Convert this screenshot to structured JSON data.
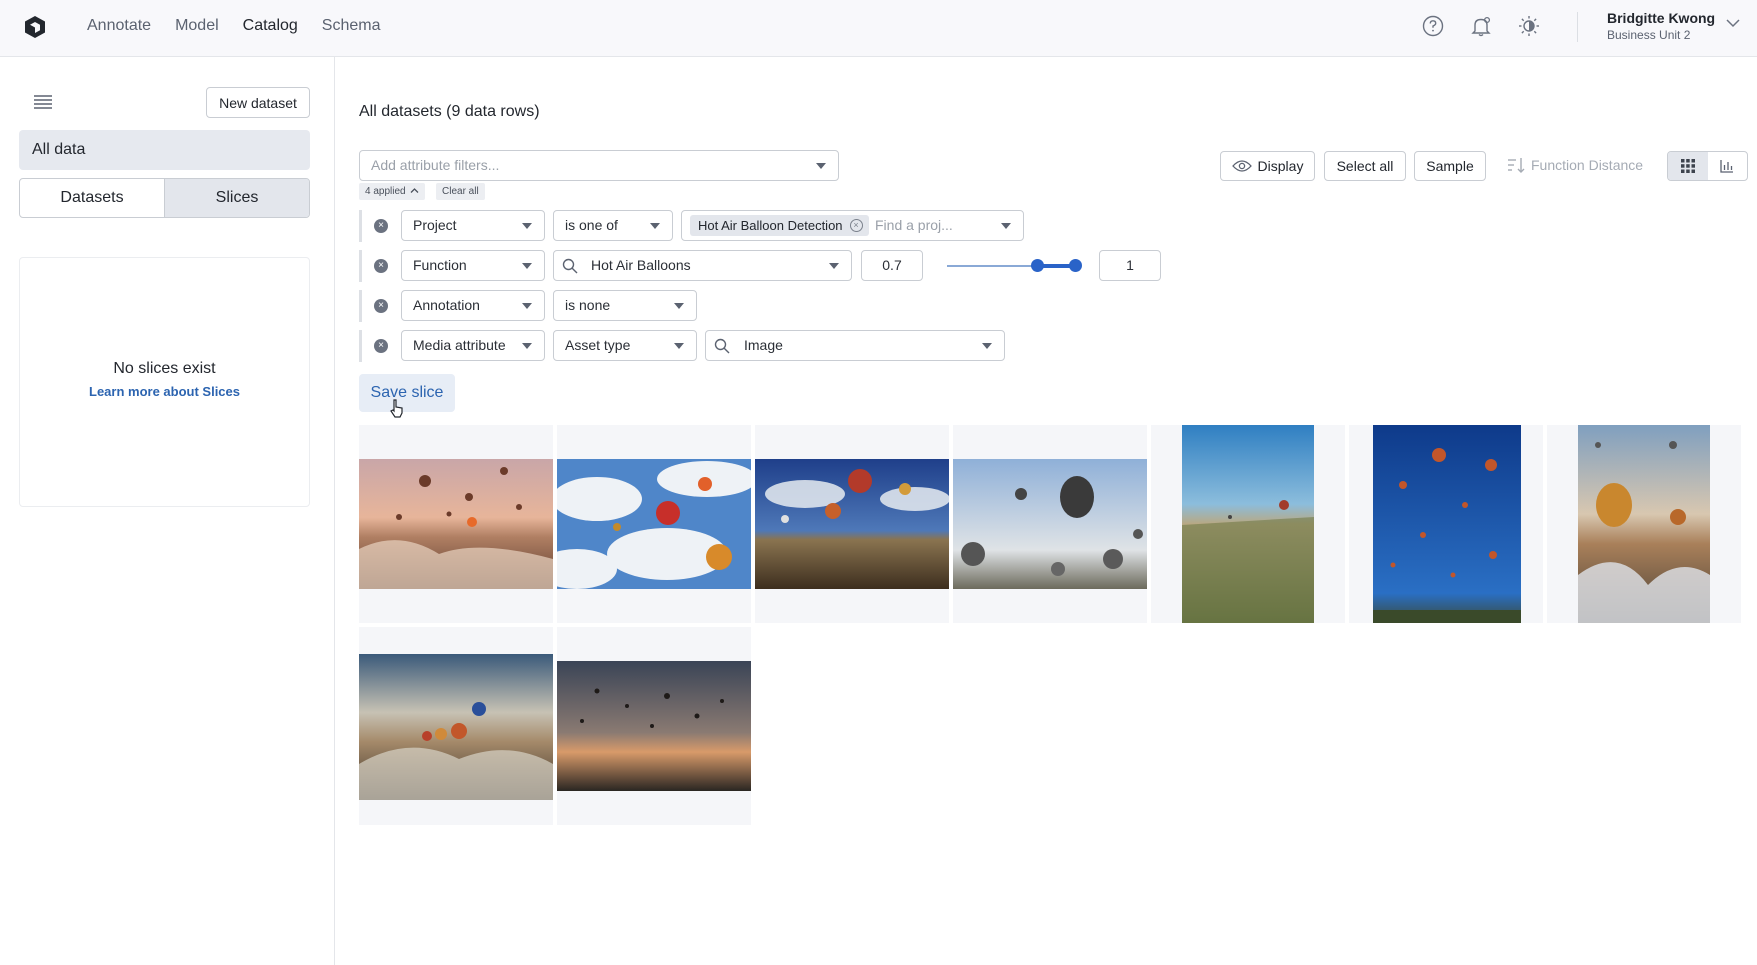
{
  "nav": {
    "items": [
      "Annotate",
      "Model",
      "Catalog",
      "Schema"
    ],
    "active": "Catalog"
  },
  "user": {
    "name": "Bridgitte Kwong",
    "unit": "Business Unit 2"
  },
  "icons": [
    "logo-icon",
    "help-icon",
    "bell-icon",
    "brightness-icon",
    "chevron-down-icon"
  ],
  "sidebar": {
    "new_dataset": "New dataset",
    "all_data": "All data",
    "tabs": [
      "Datasets",
      "Slices"
    ],
    "active_tab": "Slices",
    "empty_title": "No slices exist",
    "empty_link": "Learn more about Slices"
  },
  "main": {
    "title": "All datasets (9 data rows)",
    "filter_placeholder": "Add attribute filters...",
    "applied": "4 applied",
    "clear_all": "Clear all",
    "filters": [
      {
        "field": "Project",
        "operator": "is one of",
        "tag": "Hot Air Balloon Detection",
        "search_placeholder": "Find a proj..."
      },
      {
        "field": "Function",
        "value": "Hot Air Balloons",
        "min": "0.7",
        "max": "1"
      },
      {
        "field": "Annotation",
        "operator": "is none"
      },
      {
        "field": "Media attribute",
        "operator": "Asset type",
        "value": "Image"
      }
    ],
    "slider": {
      "min_fraction": 0.7,
      "max_fraction": 1.0
    },
    "save_slice": "Save slice",
    "toolbar": {
      "display": "Display",
      "select_all": "Select all",
      "sample": "Sample",
      "function_distance": "Function Distance"
    }
  },
  "gallery": {
    "images": [
      "balloons-sunset-valley",
      "balloons-blue-sky-clouds",
      "balloons-dark-sky-valley",
      "balloons-morning-sky",
      "balloons-portrait-valley",
      "balloons-portrait-blue-sky",
      "balloons-portrait-canyon",
      "balloons-rock-ridge",
      "balloons-dusk-horizon"
    ]
  },
  "colors": {
    "accent": "#2a63c8",
    "link": "#2c64b0",
    "sidebar_selected": "#e6e9ef"
  }
}
